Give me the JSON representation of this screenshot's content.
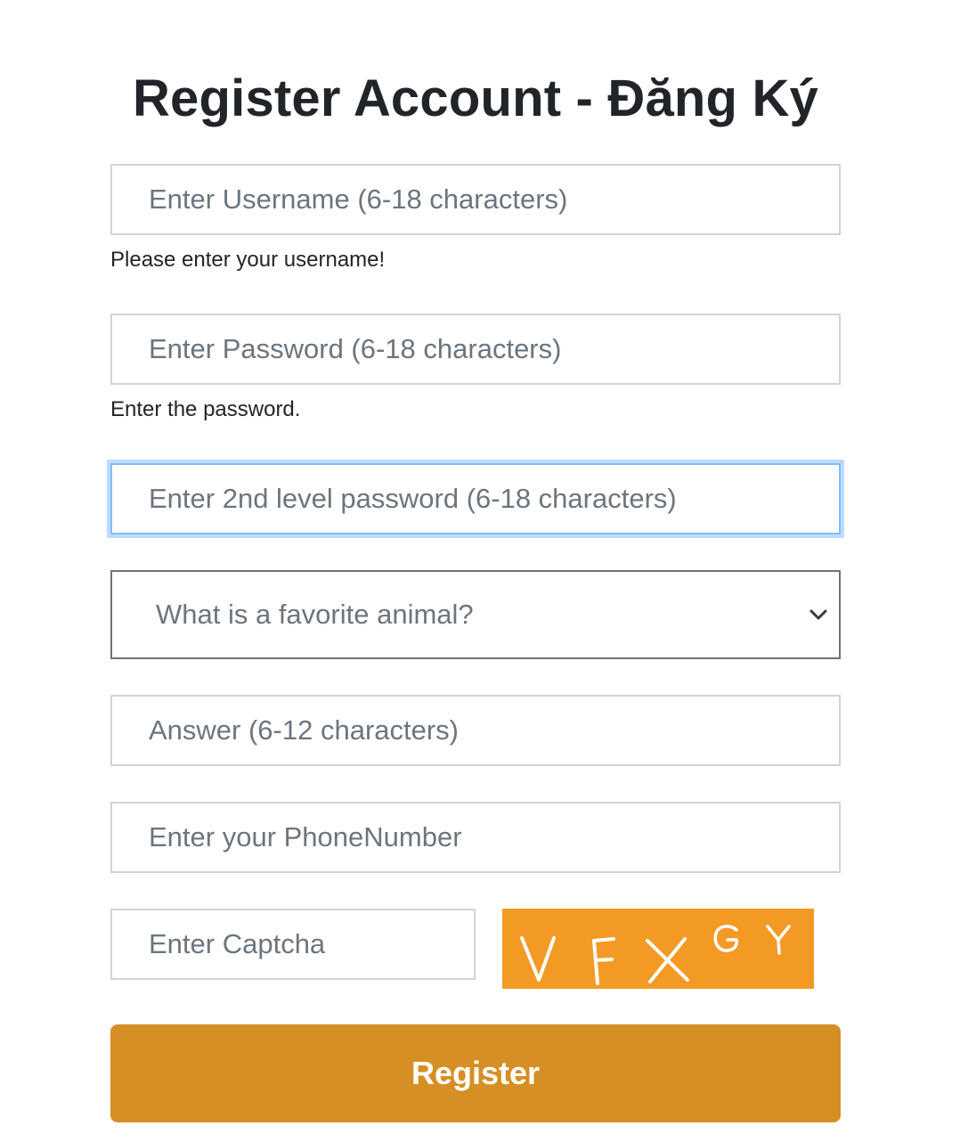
{
  "page": {
    "title": "Register Account - Đăng Ký"
  },
  "form": {
    "username": {
      "placeholder": "Enter Username (6-18 characters)",
      "hint": "Please enter your username!"
    },
    "password": {
      "placeholder": "Enter Password (6-18 characters)",
      "hint": "Enter the password."
    },
    "second_password": {
      "placeholder": "Enter 2nd level password (6-18 characters)",
      "focused": true
    },
    "security_question": {
      "selected": "What is a favorite animal?",
      "icon": "chevron-down-icon"
    },
    "answer": {
      "placeholder": "Answer (6-12 characters)"
    },
    "phone": {
      "placeholder": "Enter your PhoneNumber"
    },
    "captcha": {
      "placeholder": "Enter Captcha",
      "image_text": "VFXGY",
      "image_background": "#f39a25"
    },
    "submit_label": "Register"
  },
  "colors": {
    "accent_button": "#d68f24",
    "focus_ring": "#80bdff",
    "input_border": "#ced4da",
    "placeholder_text": "#6c757d"
  }
}
